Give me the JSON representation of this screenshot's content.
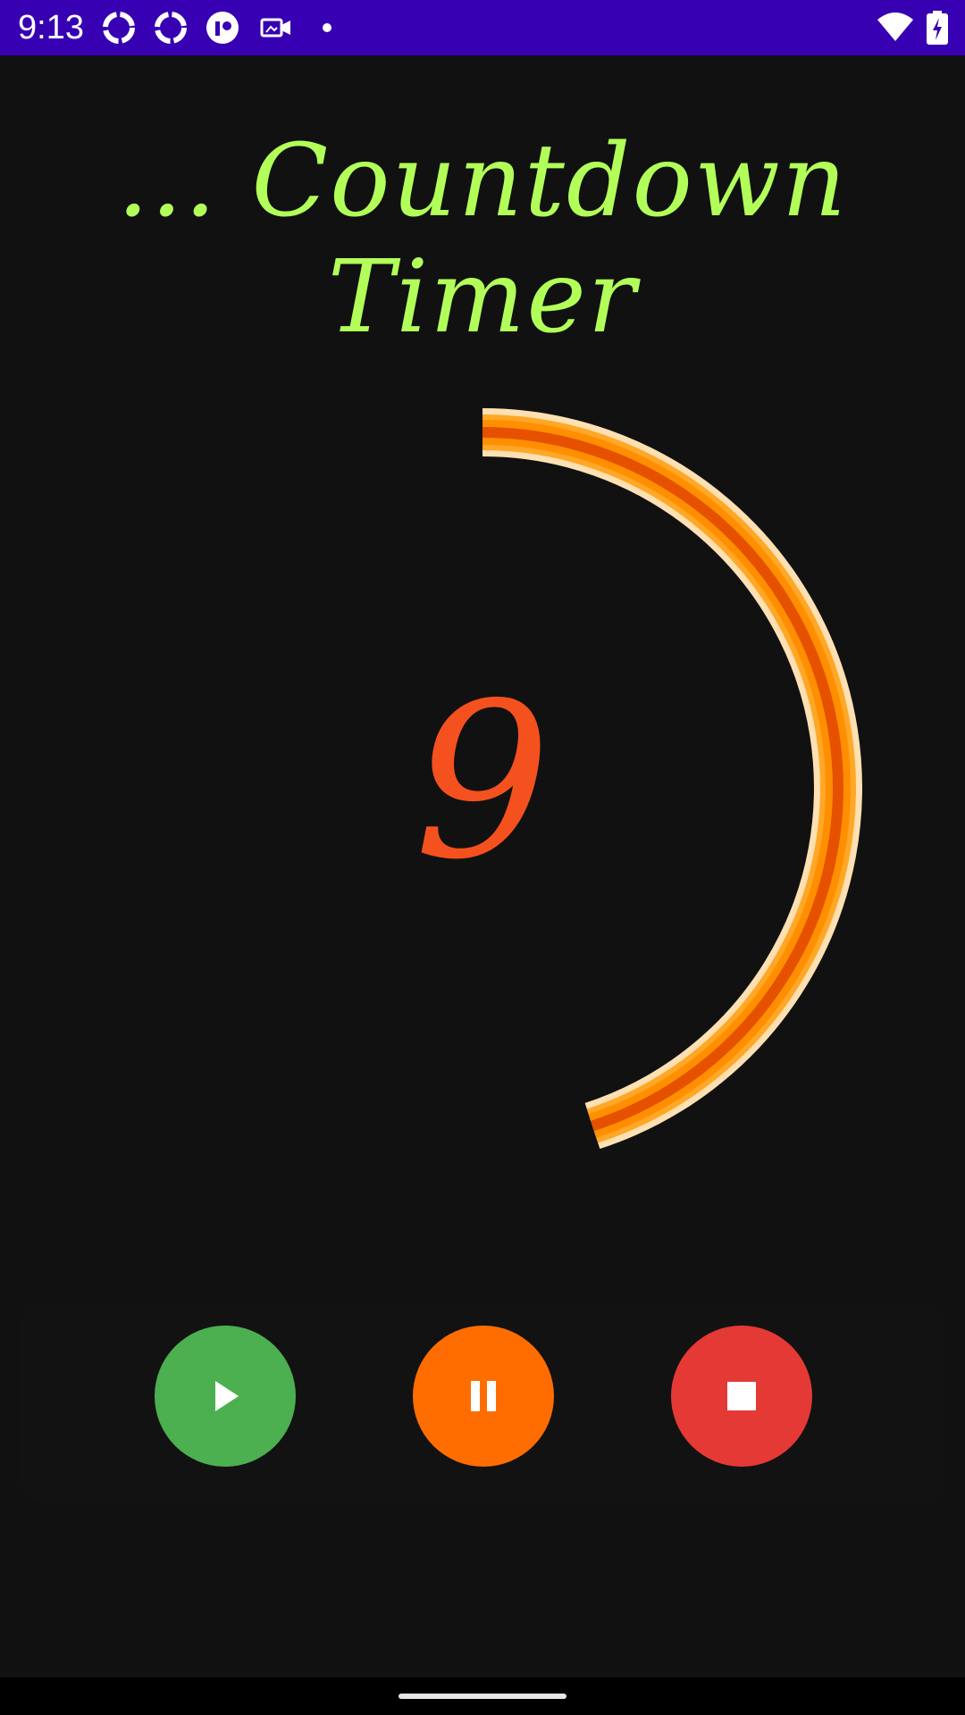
{
  "status_bar": {
    "time": "9:13",
    "left_icons": [
      "sync-icon",
      "sync-icon",
      "app-icon",
      "video-icon",
      "dot-icon"
    ],
    "right_icons": [
      "wifi-icon",
      "battery-charging-icon"
    ]
  },
  "title": "... Countdown Timer",
  "timer": {
    "remaining_seconds": "9",
    "progress_fraction": 0.45,
    "ring_colors": [
      "#FF8F00",
      "#E65100",
      "#FFE0B2"
    ]
  },
  "controls": {
    "play": {
      "icon": "play-icon",
      "color": "#4CAF50"
    },
    "pause": {
      "icon": "pause-icon",
      "color": "#FF6D00"
    },
    "stop": {
      "icon": "stop-icon",
      "color": "#E53935"
    }
  },
  "colors": {
    "background": "#111111",
    "status_bar": "#3700B3",
    "title": "#B2FF59",
    "count": "#F4511E"
  }
}
